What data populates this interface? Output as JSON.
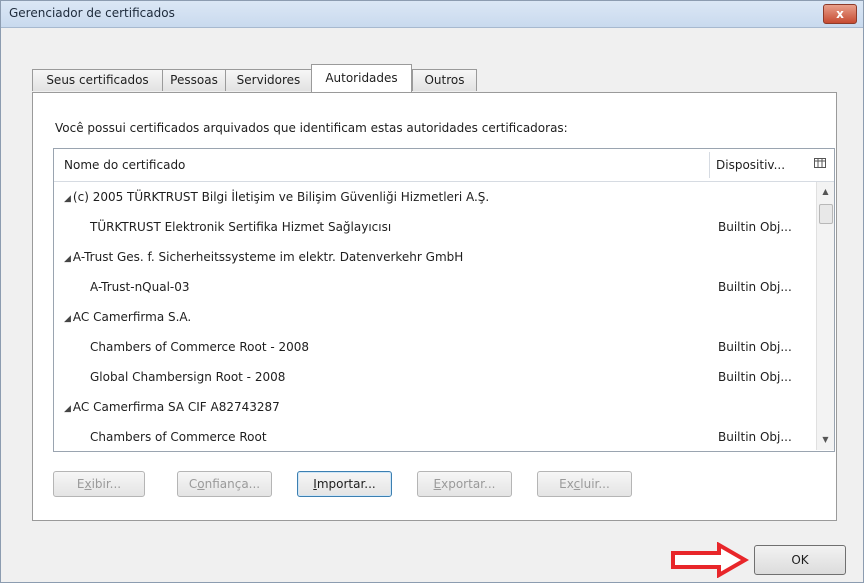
{
  "window": {
    "title": "Gerenciador de certificados",
    "close_label": "x"
  },
  "tabs": [
    {
      "label": "Seus certificados",
      "active": false
    },
    {
      "label": "Pessoas",
      "active": false
    },
    {
      "label": "Servidores",
      "active": false
    },
    {
      "label": "Autoridades",
      "active": true
    },
    {
      "label": "Outros",
      "active": false
    }
  ],
  "intro_text": "Você possui certificados arquivados que identificam estas autoridades certificadoras:",
  "table": {
    "columns": {
      "name": "Nome do certificado",
      "device": "Dispositiv..."
    },
    "column_picker_icon": "column-picker-icon",
    "rows": [
      {
        "name": "(c) 2005 TÜRKTRUST Bilgi İletişim ve Bilişim Güvenliği Hizmetleri A.Ş.",
        "device": "",
        "group": true
      },
      {
        "name": "TÜRKTRUST Elektronik Sertifika Hizmet Sağlayıcısı",
        "device": "Builtin Obj...",
        "group": false
      },
      {
        "name": "A-Trust Ges. f. Sicherheitssysteme im elektr. Datenverkehr GmbH",
        "device": "",
        "group": true
      },
      {
        "name": "A-Trust-nQual-03",
        "device": "Builtin Obj...",
        "group": false
      },
      {
        "name": "AC Camerfirma S.A.",
        "device": "",
        "group": true
      },
      {
        "name": "Chambers of Commerce Root - 2008",
        "device": "Builtin Obj...",
        "group": false
      },
      {
        "name": "Global Chambersign Root - 2008",
        "device": "Builtin Obj...",
        "group": false
      },
      {
        "name": "AC Camerfirma SA CIF A82743287",
        "device": "",
        "group": true
      },
      {
        "name": "Chambers of Commerce Root",
        "device": "Builtin Obj...",
        "group": false
      }
    ]
  },
  "buttons": {
    "view": {
      "pre": "E",
      "key": "x",
      "post": "ibir..."
    },
    "trust": {
      "pre": "C",
      "key": "o",
      "post": "nfiança..."
    },
    "import": {
      "pre": "",
      "key": "I",
      "post": "mportar..."
    },
    "export": {
      "pre": "",
      "key": "E",
      "post": "xportar..."
    },
    "delete": {
      "pre": "Ex",
      "key": "c",
      "post": "luir..."
    }
  },
  "ok_label": "OK",
  "accent_color": "#e8262a"
}
